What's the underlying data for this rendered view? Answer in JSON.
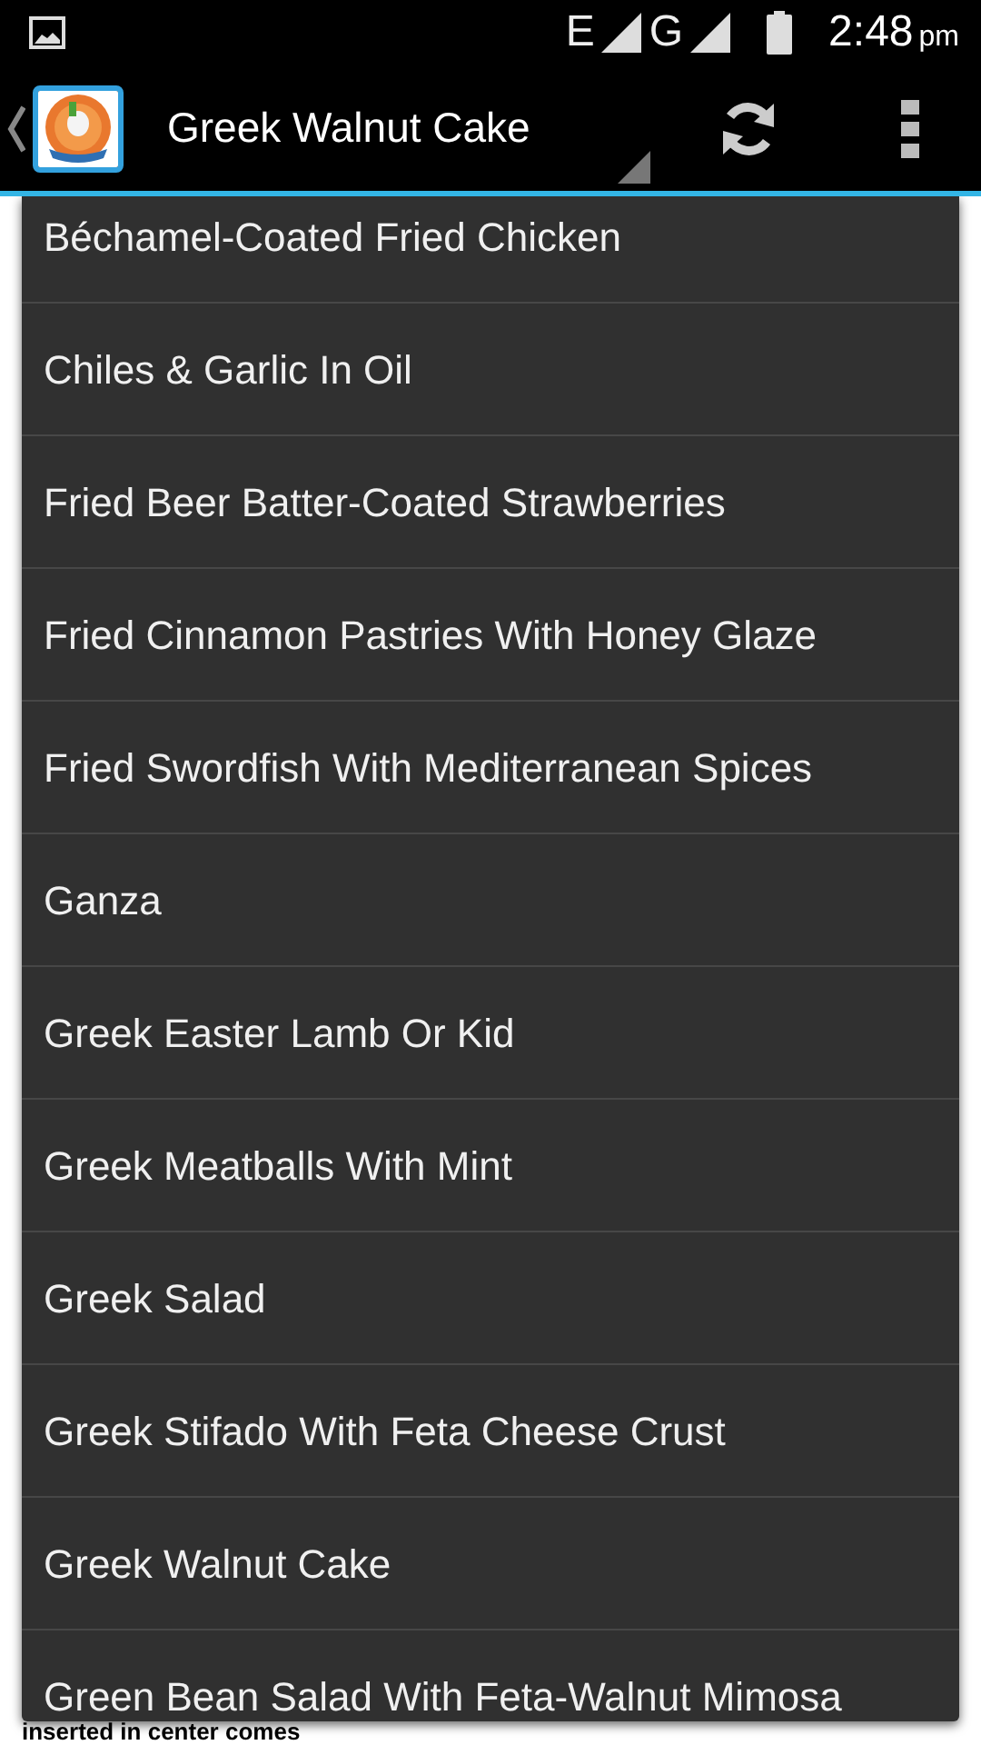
{
  "status_bar": {
    "network_1": "E",
    "network_2": "G",
    "time": "2:48",
    "time_suffix": "pm"
  },
  "action_bar": {
    "title": "Greek Walnut Cake"
  },
  "background_text": "inserted in center comes",
  "dropdown": {
    "items": [
      {
        "label": "Béchamel-Coated Fried Chicken"
      },
      {
        "label": "Chiles & Garlic In Oil"
      },
      {
        "label": "Fried Beer Batter-Coated Strawberries"
      },
      {
        "label": "Fried Cinnamon Pastries With Honey Glaze"
      },
      {
        "label": "Fried Swordfish With Mediterranean Spices"
      },
      {
        "label": "Ganza"
      },
      {
        "label": "Greek Easter Lamb Or Kid"
      },
      {
        "label": "Greek Meatballs With Mint"
      },
      {
        "label": "Greek Salad"
      },
      {
        "label": "Greek Stifado With Feta Cheese Crust"
      },
      {
        "label": "Greek Walnut Cake"
      },
      {
        "label": "Green Bean Salad With Feta-Walnut Mimosa"
      }
    ]
  }
}
